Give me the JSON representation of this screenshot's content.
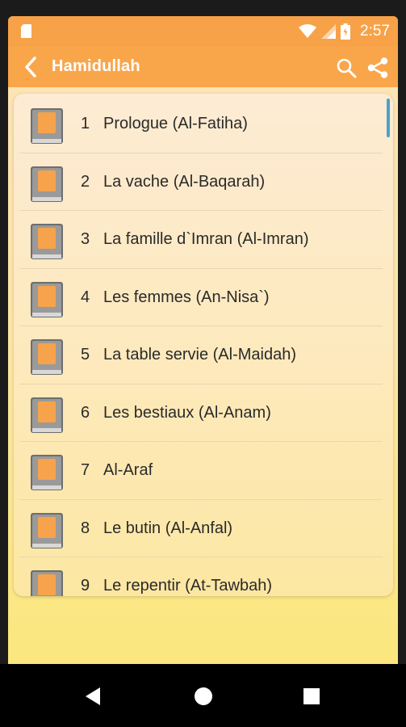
{
  "status_bar": {
    "time": "2:57",
    "icons": [
      "sim-card-icon",
      "wifi-icon",
      "cellular-signal-icon",
      "battery-icon"
    ]
  },
  "app_bar": {
    "title": "Hamidullah",
    "icons": [
      "back-arrow-icon",
      "search-icon",
      "share-icon"
    ]
  },
  "chapters": [
    {
      "number": "1",
      "title": "Prologue (Al-Fatiha)"
    },
    {
      "number": "2",
      "title": "La vache (Al-Baqarah)"
    },
    {
      "number": "3",
      "title": "La famille d`Imran (Al-Imran)"
    },
    {
      "number": "4",
      "title": "Les femmes (An-Nisa`)"
    },
    {
      "number": "5",
      "title": "La table servie (Al-Maidah)"
    },
    {
      "number": "6",
      "title": "Les bestiaux (Al-Anam)"
    },
    {
      "number": "7",
      "title": "Al-Araf"
    },
    {
      "number": "8",
      "title": "Le butin (Al-Anfal)"
    },
    {
      "number": "9",
      "title": "Le repentir (At-Tawbah)"
    }
  ],
  "nav_bar": {
    "icons": [
      "nav-back-icon",
      "nav-home-icon",
      "nav-recents-icon"
    ]
  },
  "colors": {
    "app_bar": "#f9a64b",
    "status_bar": "#f7a248",
    "background_bottom": "#fbe77d",
    "scroll_indicator": "#4aa3c9"
  }
}
